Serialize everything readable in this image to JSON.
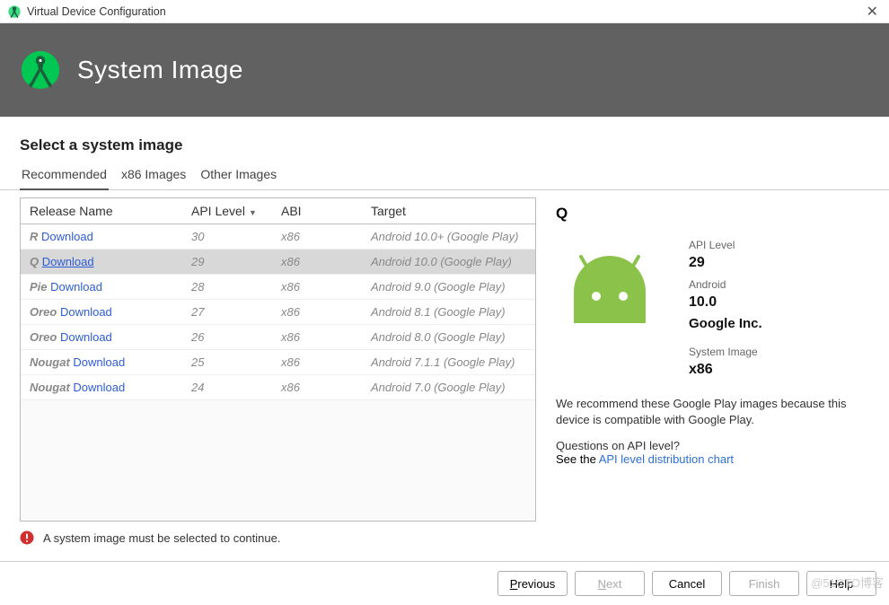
{
  "window": {
    "title": "Virtual Device Configuration"
  },
  "header": {
    "title": "System Image"
  },
  "subheading": "Select a system image",
  "tabs": {
    "recommended": "Recommended",
    "x86": "x86 Images",
    "other": "Other Images"
  },
  "columns": {
    "release": "Release Name",
    "api": "API Level",
    "abi": "ABI",
    "target": "Target"
  },
  "dl_label": "Download",
  "rows": [
    {
      "name": "R",
      "api": "30",
      "abi": "x86",
      "target": "Android 10.0+ (Google Play)"
    },
    {
      "name": "Q",
      "api": "29",
      "abi": "x86",
      "target": "Android 10.0 (Google Play)"
    },
    {
      "name": "Pie",
      "api": "28",
      "abi": "x86",
      "target": "Android 9.0 (Google Play)"
    },
    {
      "name": "Oreo",
      "api": "27",
      "abi": "x86",
      "target": "Android 8.1 (Google Play)"
    },
    {
      "name": "Oreo",
      "api": "26",
      "abi": "x86",
      "target": "Android 8.0 (Google Play)"
    },
    {
      "name": "Nougat",
      "api": "25",
      "abi": "x86",
      "target": "Android 7.1.1 (Google Play)"
    },
    {
      "name": "Nougat",
      "api": "24",
      "abi": "x86",
      "target": "Android 7.0 (Google Play)"
    }
  ],
  "details": {
    "title": "Q",
    "api_label": "API Level",
    "api_value": "29",
    "android_label": "Android",
    "android_value": "10.0",
    "vendor": "Google Inc.",
    "sysimg_label": "System Image",
    "sysimg_value": "x86",
    "recommend": "We recommend these Google Play images because this device is compatible with Google Play.",
    "question": "Questions on API level?",
    "see_the": "See the ",
    "chart_link": "API level distribution chart"
  },
  "error": "A system image must be selected to continue.",
  "buttons": {
    "previous": "Previous",
    "next": "Next",
    "cancel": "Cancel",
    "finish": "Finish",
    "help": "Help"
  },
  "watermark": "@51CTO博客"
}
